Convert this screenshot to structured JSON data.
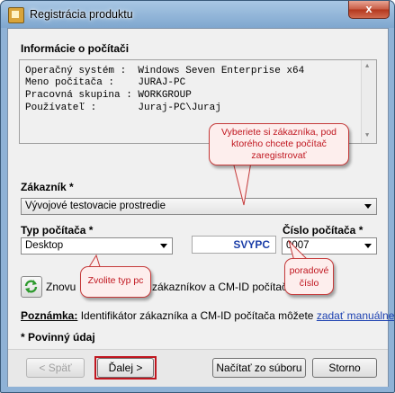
{
  "window": {
    "title": "Registrácia produktu",
    "close_glyph": "x"
  },
  "info": {
    "heading": "Informácie o počítači",
    "rows": [
      "Operačný systém :  Windows Seven Enterprise x64",
      "Meno počítača :    JURAJ-PC",
      "Pracovná skupina : WORKGROUP",
      "Používateľ :       Juraj-PC\\Juraj"
    ]
  },
  "customer": {
    "label": "Zákazník *",
    "selected": "Vývojové testovacie prostredie"
  },
  "pc_type": {
    "label": "Typ počítača *",
    "selected": "Desktop"
  },
  "pc_code": "SVYPC",
  "pc_number": {
    "label": "Číslo počítača *",
    "selected": "0007"
  },
  "refresh_text": {
    "before": "Znovu",
    "after": "zákazníkov a CM-ID počítača z"
  },
  "note": {
    "label": "Poznámka:",
    "text": "Identifikátor zákazníka a CM-ID počítača môžete",
    "link": "zadať manuálne"
  },
  "required_note": "* Povinný údaj",
  "buttons": {
    "back": "< Späť",
    "next": "Ďalej >",
    "load": "Načítať zo súboru",
    "cancel": "Storno"
  },
  "callouts": {
    "customer": "Vyberiete si zákazníka, pod ktorého chcete počítač zaregistrovať",
    "pc_type": "Zvolite typ pc",
    "number": "poradové číslo"
  },
  "colors": {
    "callout_text": "#c0161f",
    "code_text": "#1b3ea8",
    "link": "#1a3fb0"
  }
}
